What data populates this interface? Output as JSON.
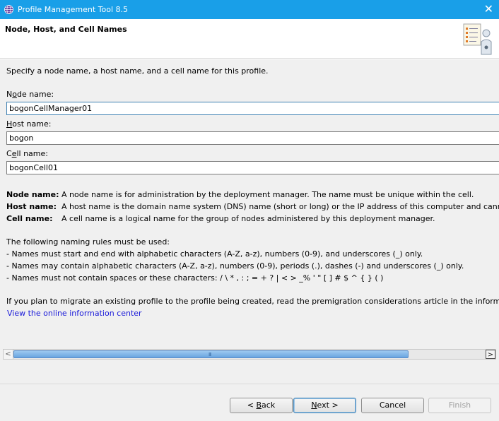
{
  "window": {
    "title": "Profile Management Tool 8.5",
    "close_glyph": "✕",
    "titlebar_color": "#199fe8",
    "app_icon": "globe-icon"
  },
  "banner": {
    "heading": "Node, Host, and Cell Names",
    "icon": "checklist-person-icon"
  },
  "intro": "Specify a node name, a host name, and a cell name for this profile.",
  "fields": {
    "node": {
      "label_pre": "N",
      "label_mnemonic": "o",
      "label_post": "de name:",
      "value": "bogonCellManager01"
    },
    "host": {
      "label_pre": "",
      "label_mnemonic": "H",
      "label_post": "ost name:",
      "value": "bogon"
    },
    "cell": {
      "label_pre": "C",
      "label_mnemonic": "e",
      "label_post": "ll name:",
      "value": "bogonCell01"
    }
  },
  "definitions": [
    {
      "term": "Node name:",
      "text": "A node name is for administration by the deployment manager. The name must be unique within the cell."
    },
    {
      "term": "Host name:",
      "text": "A host name is the domain name system (DNS) name (short or long) or the IP address of this computer and cannot"
    },
    {
      "term": "Cell name:",
      "text": "A cell name is a logical name for the group of nodes administered by this deployment manager."
    }
  ],
  "rules": {
    "intro": "The following naming rules must be used:",
    "items": [
      "- Names must start and end with alphabetic characters (A-Z, a-z), numbers (0-9), and underscores (_) only.",
      "- Names may contain alphabetic characters (A-Z, a-z), numbers (0-9), periods (.), dashes (-) and underscores (_) only.",
      "- Names must not contain spaces or these characters: / \\ * , : ; = + ? | < > _% ' \" [ ] # $ ^ { } ( )"
    ]
  },
  "migrate_text": "If you plan to migrate an existing profile to the profile being created, read the premigration considerations article in the informatio",
  "info_link": "View the online information center",
  "scrollbar": {
    "left_arrow": "<",
    "right_arrow": ">",
    "grip": "III"
  },
  "buttons": {
    "back_pre": "< ",
    "back_mnemonic": "B",
    "back_post": "ack",
    "next_mnemonic": "N",
    "next_post": "ext >",
    "cancel": "Cancel",
    "finish": "Finish"
  }
}
